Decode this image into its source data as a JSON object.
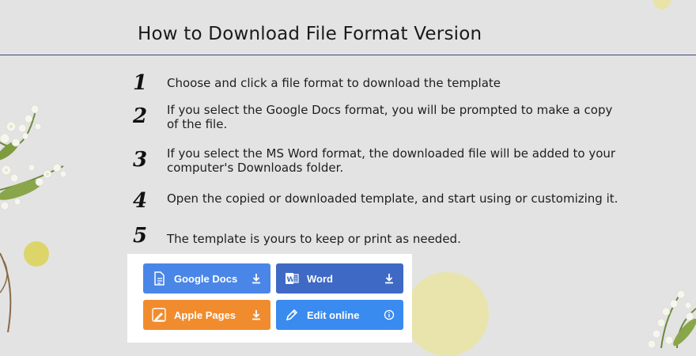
{
  "title": "How to Download File Format Version",
  "steps": [
    {
      "number": "1",
      "text": "Choose and click a file format to download the template"
    },
    {
      "number": "2",
      "text": "If you select the Google Docs format, you will be prompted to make a copy of the file."
    },
    {
      "number": "3",
      "text": "If you select the MS Word format, the downloaded file will be added to your computer's Downloads folder."
    },
    {
      "number": "4",
      "text": "Open the copied or downloaded template, and start using or customizing it."
    },
    {
      "number": "5",
      "text": "The template is yours to keep or print as needed."
    }
  ],
  "buttons": [
    {
      "label": "Google Docs",
      "icon": "document-icon",
      "action_icon": "download-icon",
      "color": "#4a86e8"
    },
    {
      "label": "Word",
      "icon": "word-icon",
      "action_icon": "download-icon",
      "color": "#3e69c5"
    },
    {
      "label": "Apple Pages",
      "icon": "pages-pen-icon",
      "action_icon": "download-icon",
      "color": "#f08c2e"
    },
    {
      "label": "Edit online",
      "icon": "pencil-icon",
      "action_icon": "info-icon",
      "color": "#3a8bf0"
    }
  ]
}
